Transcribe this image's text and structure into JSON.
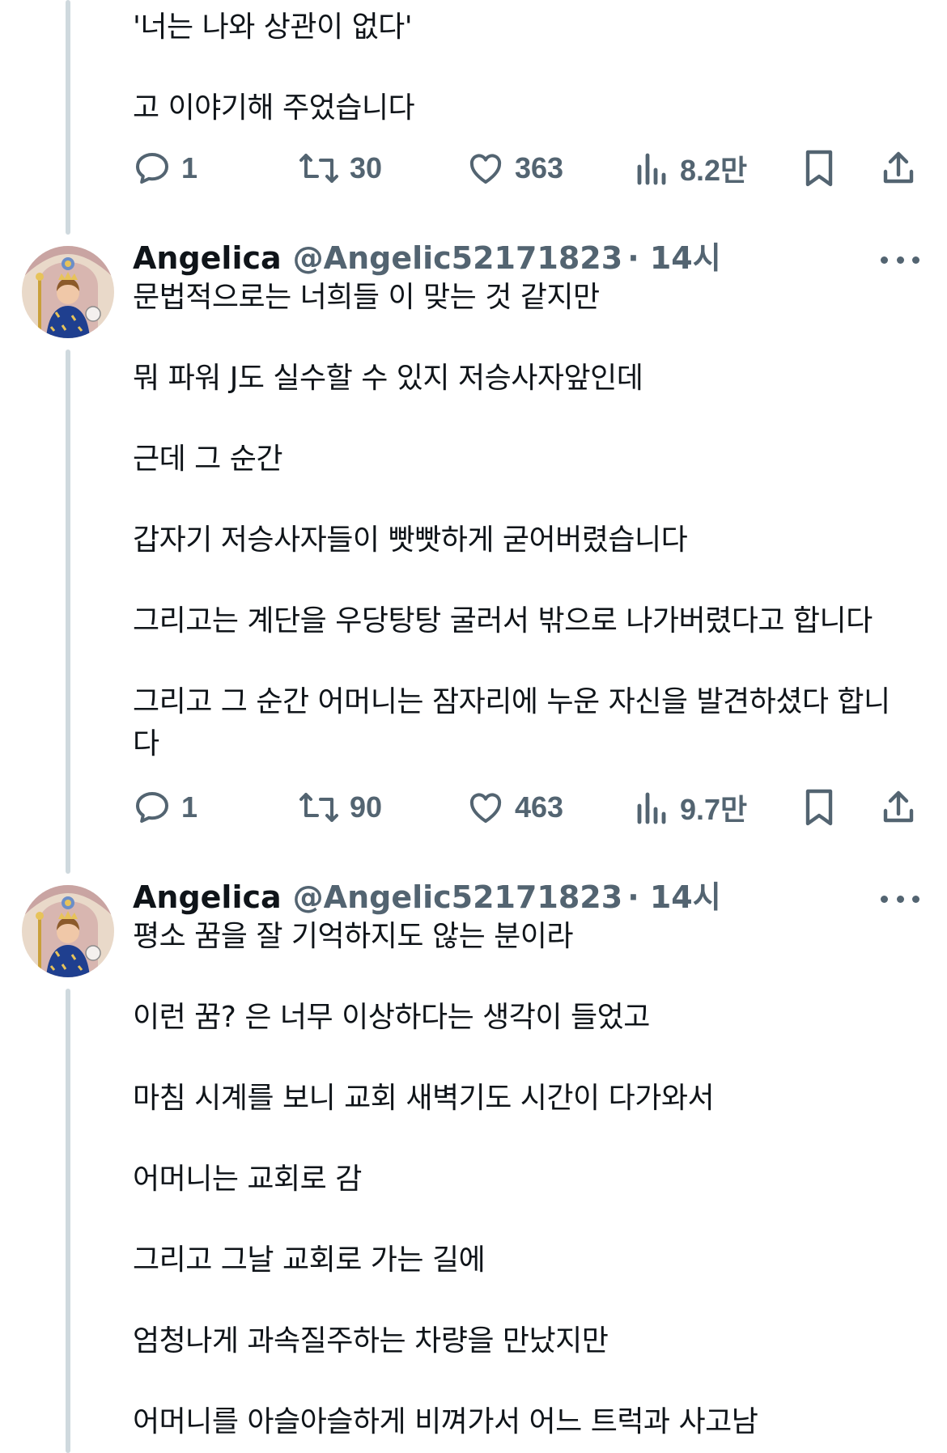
{
  "tweet0": {
    "lines": [
      "'너는 나와 상관이 없다'",
      "고 이야기해 주었습니다"
    ],
    "replies": "1",
    "retweets": "30",
    "likes": "363",
    "views": "8.2만"
  },
  "tweet1": {
    "name": "Angelica",
    "handle": "@Angelic52171823",
    "time": "· 14시",
    "lines": [
      "문법적으로는 너희들 이 맞는 것 같지만",
      "뭐 파워 J도 실수할 수 있지 저승사자앞인데",
      "근데 그 순간",
      "갑자기 저승사자들이 빳빳하게 굳어버렸습니다",
      "그리고는 계단을 우당탕탕 굴러서 밖으로 나가버렸다고 합니다",
      "그리고 그 순간 어머니는 잠자리에 누운 자신을 발견하셨다 합니",
      "다"
    ],
    "replies": "1",
    "retweets": "90",
    "likes": "463",
    "views": "9.7만"
  },
  "tweet2": {
    "name": "Angelica",
    "handle": "@Angelic52171823",
    "time": "· 14시",
    "lines": [
      "평소 꿈을 잘 기억하지도 않는 분이라",
      "이런 꿈? 은 너무 이상하다는 생각이 들었고",
      "마침 시계를 보니 교회 새벽기도 시간이 다가와서",
      "어머니는 교회로 감",
      "그리고 그날 교회로 가는 길에",
      "엄청나게 과속질주하는 차량을 만났지만",
      "어머니를 아슬아슬하게 비껴가서 어느 트럭과 사고남"
    ]
  },
  "colors": {
    "text": "#0f1419",
    "secondary": "#536471",
    "thread_line": "#cfd9de"
  },
  "icons": [
    "reply-icon",
    "retweet-icon",
    "like-icon",
    "views-icon",
    "bookmark-icon",
    "share-icon",
    "more-icon"
  ]
}
